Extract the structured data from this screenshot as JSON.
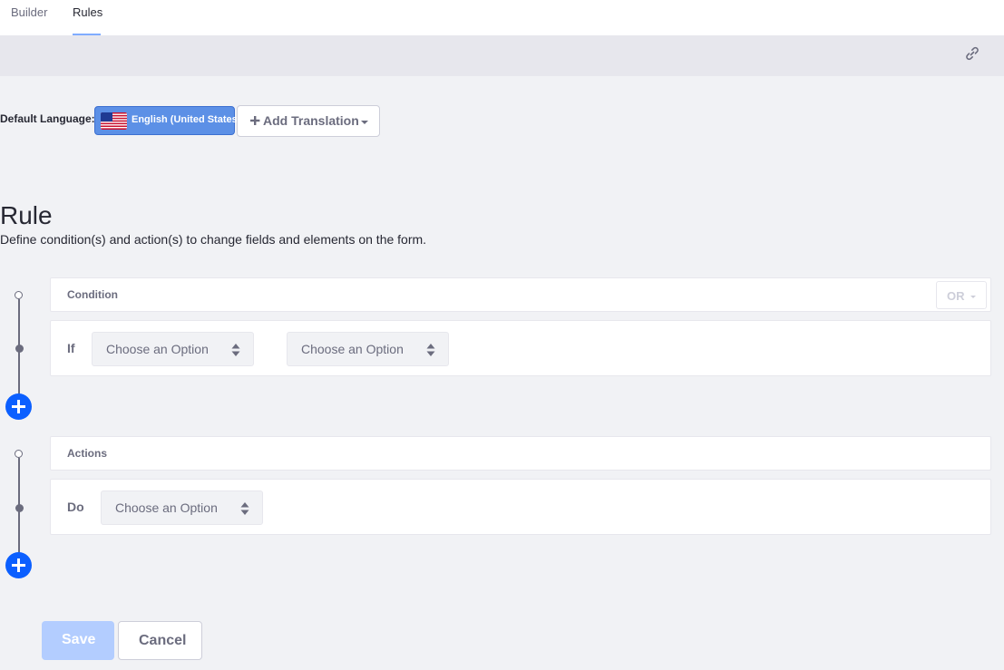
{
  "tabs": [
    {
      "label": "Builder",
      "active": false
    },
    {
      "label": "Rules",
      "active": true
    }
  ],
  "toolbar": {
    "icon": "link-icon"
  },
  "language": {
    "label": "Default Language:",
    "current": "English (United States)",
    "flag_icon": "us-flag-icon",
    "add_translation_label": "Add Translation"
  },
  "rule": {
    "title": "Rule",
    "description": "Define condition(s) and action(s) to change fields and elements on the form."
  },
  "condition": {
    "title": "Condition",
    "operator": "OR",
    "if_label": "If",
    "first_select": "Choose an Option",
    "second_select": "Choose an Option"
  },
  "actions": {
    "title": "Actions",
    "do_label": "Do",
    "select": "Choose an Option"
  },
  "footer": {
    "save_label": "Save",
    "cancel_label": "Cancel"
  },
  "colors": {
    "primary": "#0b5fff",
    "language_button": "#5c90e6",
    "save_disabled": "#b3cdff",
    "background": "#f1f2f5"
  }
}
